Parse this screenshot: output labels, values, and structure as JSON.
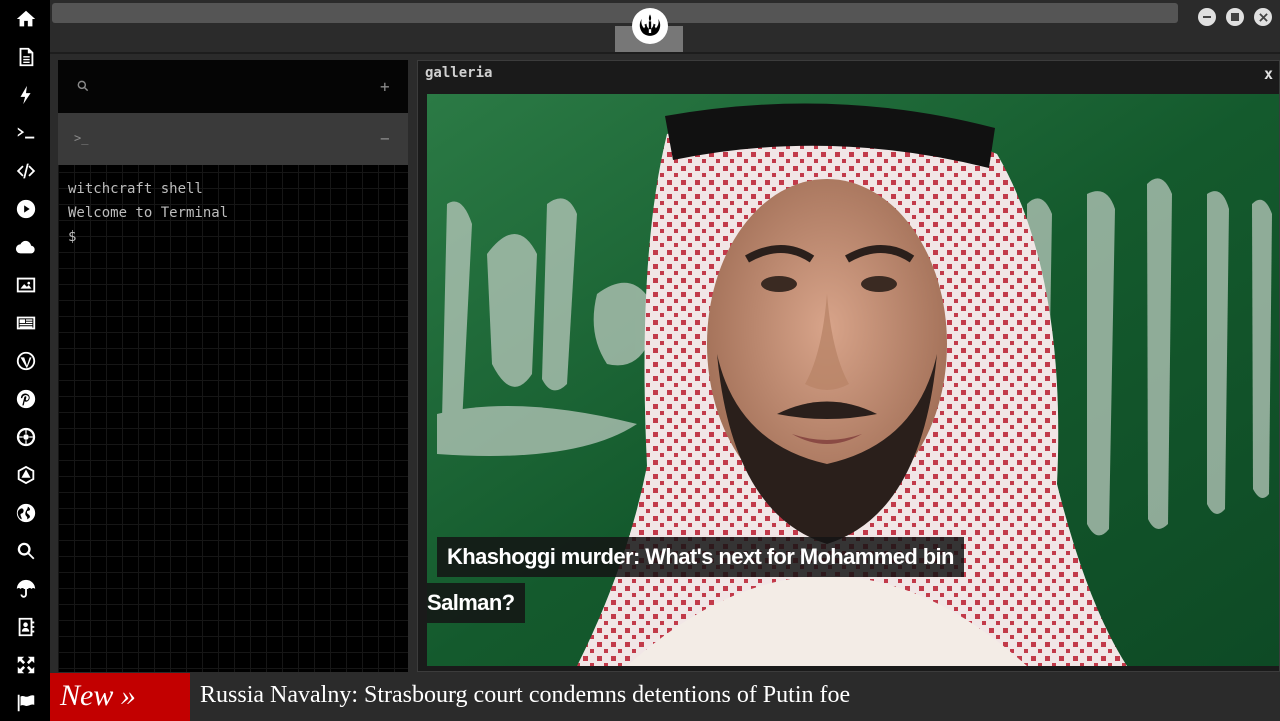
{
  "sidebar": {
    "icons": [
      "home-icon",
      "document-icon",
      "bolt-icon",
      "terminal-icon",
      "code-icon",
      "play-icon",
      "cloud-icon",
      "image-icon",
      "newspaper-icon",
      "wordpress-icon",
      "pinterest-icon",
      "galactic-empire-icon",
      "geometric-icon",
      "globe-icon",
      "search-icon",
      "umbrella-icon",
      "contacts-icon",
      "expand-icon",
      "flag-icon"
    ]
  },
  "window": {
    "logo": "rebel-alliance-icon"
  },
  "terminal": {
    "tab_prompt": ">_",
    "output": [
      "witchcraft shell",
      "Welcome to Terminal",
      "$"
    ]
  },
  "galleria": {
    "title": "galleria",
    "close": "x",
    "caption_line1": "Khashoggi murder: What's next for Mohammed bin",
    "caption_line2": "Salman?"
  },
  "ticker": {
    "label": "New »",
    "headline": "Russia Navalny: Strasbourg court condemns detentions of Putin foe",
    "label_color": "#c20000"
  }
}
